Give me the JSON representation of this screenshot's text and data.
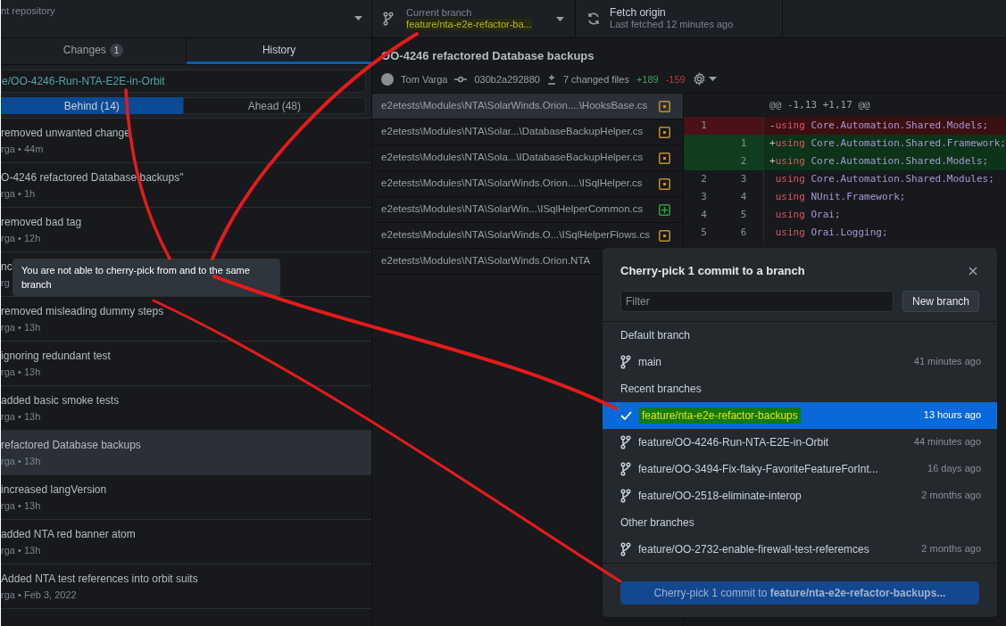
{
  "toolbar": {
    "repository": {
      "label": "nt repository"
    },
    "branch": {
      "label": "Current branch",
      "name": "feature/nta-e2e-refactor-ba..."
    },
    "fetch": {
      "label": "Fetch origin",
      "detail": "Last fetched 12 minutes ago"
    }
  },
  "sidebar": {
    "tabs": [
      {
        "label": "Changes",
        "count": "1",
        "selected": false
      },
      {
        "label": "History",
        "selected": true
      }
    ],
    "compare_branch": {
      "value": "e/OO-4246-Run-NTA-E2E-in-Orbit"
    },
    "segments": [
      {
        "label": "Behind (14)",
        "selected": true
      },
      {
        "label": "Ahead (48)",
        "selected": false
      }
    ],
    "commits": [
      {
        "title": "removed unwanted change",
        "meta": "rga • 44m",
        "selected": false
      },
      {
        "title": "O-4246 refactored Database backups\"",
        "meta": "rga • 1h",
        "selected": false
      },
      {
        "title": "removed bad tag",
        "meta": "rga • 12h",
        "selected": false
      },
      {
        "title": "nc",
        "meta": "rg",
        "selected": false
      },
      {
        "title": "removed misleading dummy steps",
        "meta": "rga • 13h",
        "selected": false
      },
      {
        "title": "ignoring redundant test",
        "meta": "rga • 13h",
        "selected": false
      },
      {
        "title": "added basic smoke tests",
        "meta": "rga • 13h",
        "selected": false
      },
      {
        "title": "refactored Database backups",
        "meta": "rga • 13h",
        "selected": true
      },
      {
        "title": "increased langVersion",
        "meta": "rga • 13h",
        "selected": false
      },
      {
        "title": "added NTA red banner atom",
        "meta": "rga • 13h",
        "selected": false
      },
      {
        "title": "Added NTA test references into orbit suits",
        "meta": "rga • Feb 3, 2022",
        "selected": false
      }
    ]
  },
  "tooltip": "You are not able to cherry-pick from and to the same branch",
  "commit": {
    "title": "OO-4246 refactored Database backups",
    "author": "Tom Varga",
    "sha": "030b2a292880",
    "files_changed": "7 changed files",
    "additions": "+189",
    "deletions": "-159"
  },
  "files": [
    {
      "path": "e2etests\\Modules\\NTA\\SolarWinds.Orion....\\HooksBase.cs",
      "kind": "modified",
      "selected": true
    },
    {
      "path": "e2etests\\Modules\\NTA\\Solar...\\DatabaseBackupHelper.cs",
      "kind": "modified",
      "selected": false
    },
    {
      "path": "e2etests\\Modules\\NTA\\Sola...\\IDatabaseBackupHelper.cs",
      "kind": "modified",
      "selected": false
    },
    {
      "path": "e2etests\\Modules\\NTA\\SolarWinds.Orion....\\ISqlHelper.cs",
      "kind": "modified",
      "selected": false
    },
    {
      "path": "e2etests\\Modules\\NTA\\SolarWin...\\ISqlHelperCommon.cs",
      "kind": "added",
      "selected": false
    },
    {
      "path": "e2etests\\Modules\\NTA\\SolarWinds.O...\\ISqlHelperFlows.cs",
      "kind": "modified",
      "selected": false
    },
    {
      "path": "e2etests\\Modules\\NTA\\SolarWinds.Orion.NTA",
      "selected": false
    }
  ],
  "diff": {
    "hunk": "@@ -1,13 +1,17 @@",
    "lines": [
      {
        "kind": "deleted",
        "old": "1",
        "marker": "-",
        "keyword": "using",
        "code": " Core.Automation.Shared.Models;"
      },
      {
        "kind": "added",
        "new": "1",
        "marker": "+",
        "keyword": "using",
        "code": " Core.Automation.Shared.Framework;"
      },
      {
        "kind": "added",
        "new": "2",
        "marker": "+",
        "keyword": "using",
        "code": " Core.Automation.Shared.Models;"
      },
      {
        "kind": "context",
        "old": "2",
        "new": "3",
        "keyword": "using",
        "code": " Core.Automation.Shared.Modules;"
      },
      {
        "kind": "context",
        "old": "3",
        "new": "4",
        "keyword": "using",
        "code": " NUnit.Framework;"
      },
      {
        "kind": "context",
        "old": "4",
        "new": "5",
        "keyword": "using",
        "code": " Orai;"
      },
      {
        "kind": "context",
        "old": "5",
        "new": "6",
        "keyword": "using",
        "code": " Orai.Logging;"
      }
    ]
  },
  "dialog": {
    "title": "Cherry-pick 1 commit to a branch",
    "filter": {
      "placeholder": "Filter"
    },
    "new_branch": "New branch",
    "groups": [
      {
        "heading": "Default branch",
        "branches": [
          {
            "name": "main",
            "time": "41 minutes ago",
            "selected": false
          }
        ]
      },
      {
        "heading": "Recent branches",
        "branches": [
          {
            "name": "feature/nta-e2e-refactor-backups",
            "time": "13 hours ago",
            "selected": true
          },
          {
            "name": "feature/OO-4246-Run-NTA-E2E-in-Orbit",
            "time": "44 minutes ago",
            "selected": false
          },
          {
            "name": "feature/OO-3494-Fix-flaky-FavoriteFeatureForInt...",
            "time": "16 days ago",
            "selected": false
          },
          {
            "name": "feature/OO-2518-eliminate-interop",
            "time": "2 months ago",
            "selected": false
          }
        ]
      },
      {
        "heading": "Other branches",
        "branches": [
          {
            "name": "feature/OO-2732-enable-firewall-test-referemces",
            "time": "2 months ago",
            "selected": false
          }
        ]
      }
    ],
    "submit": {
      "text": "Cherry-pick 1 commit to **feature/nta-e2e-refactor-backups...**"
    }
  }
}
